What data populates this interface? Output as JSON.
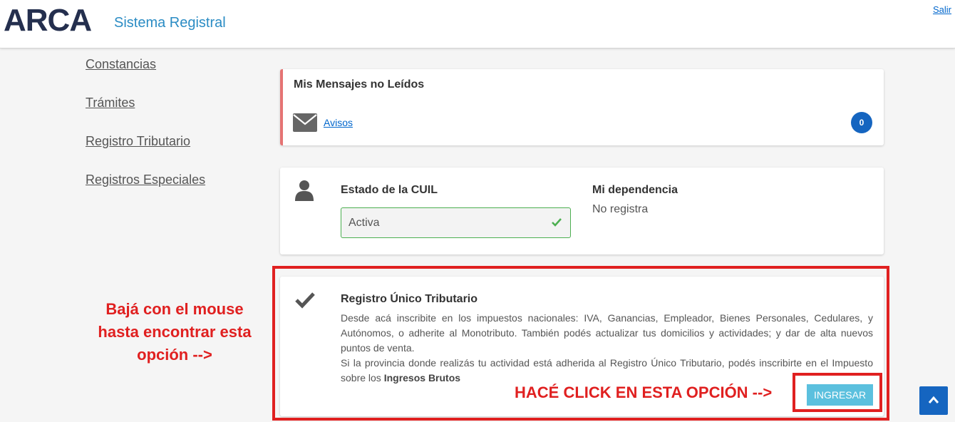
{
  "header": {
    "logo": "ARCA",
    "subtitle": "Sistema Registral",
    "logout": "Salir"
  },
  "sidebar": {
    "items": [
      {
        "label": "Constancias"
      },
      {
        "label": "Trámites"
      },
      {
        "label": "Registro Tributario"
      },
      {
        "label": "Registros Especiales"
      }
    ]
  },
  "messages": {
    "title": "Mis Mensajes no Leídos",
    "link": "Avisos",
    "count": "0"
  },
  "cuil": {
    "title": "Estado de la CUIL",
    "value": "Activa",
    "dependency_title": "Mi dependencia",
    "dependency_value": "No registra"
  },
  "rut": {
    "title": "Registro Único Tributario",
    "description_1": "Desde acá inscribite en los impuestos nacionales: IVA, Ganancias, Empleador, Bienes Personales, Cedulares, y Autónomos, o adherite al Monotributo. También podés actualizar tus domicilios y actividades; y dar de alta nuevos puntos de venta.",
    "description_2_prefix": "Si la provincia donde realizás tu actividad está adherida al Registro Único Tributario, podés inscribirte en el Impuesto sobre los ",
    "description_2_bold": "Ingresos Brutos",
    "button": "INGRESAR"
  },
  "annotations": {
    "left_line1": "Bajá con el mouse",
    "left_line2": "hasta encontrar esta",
    "left_line3": "opción -->",
    "click": "HACÉ CLICK EN ESTA OPCIÓN -->"
  },
  "colors": {
    "brand_navy": "#242f4e",
    "brand_blue": "#2b8cc4",
    "annotation_red": "#e02020",
    "button_cyan": "#5bc0de",
    "success_green": "#4caf50"
  },
  "icons": {
    "messages": "envelope-icon",
    "cuil": "user-icon",
    "cuil_status": "check-icon",
    "rut": "checkmark-icon",
    "scroll": "chevron-up-icon"
  }
}
